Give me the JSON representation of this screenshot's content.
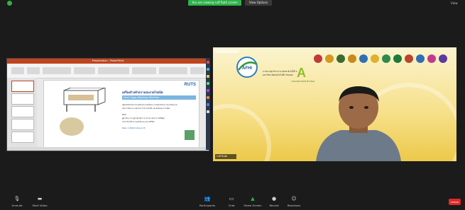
{
  "top_bar": {
    "share_banner": "You are viewing ruff Ruth screen",
    "view_options": "View Options",
    "view_label": "View"
  },
  "ppt": {
    "window_title": "Presentation - PowerPoint",
    "slide": {
      "brand": "RUTS",
      "title": "เครื่องล้างทำความสะอาดไข่เป็ด",
      "subtitle": "Duck Eggs Washing Machine",
      "body_lines": [
        "ผลิตภัณฑ์นวัตกรรมเครื่องล้างไข่เป็ดแบบ Interactive ไซเบอร์ต้นแบบ",
        "ลดการใช้แรงงานคนในการล้างไข่เป็ด และลดต้นทุนการผลิต",
        "",
        "Ruth",
        "ผู้ดำเนินงาน: ผู้ช่วยศาสตราจารย์ ดร.สมชาย ใจดีมีสุข",
        "สาขาวิชาวิศวกรรมเครื่องกล มทร.ศรีวิชัย",
        "",
        "ติดต่อ: ruth@rmutsv.ac.th"
      ]
    }
  },
  "video": {
    "name": "ruff Ruth",
    "org_logo_text": "AFHI",
    "org_subtext": "การประชุมวิชาการระดับชาติ ครั้งที่ 3 มหาวิทยาลัยเทคโนโลยีราชมงคล",
    "event_logo_text": "A",
    "event_subtext": "งานเกษตรแห่งชาติ 2564"
  },
  "toolbar": {
    "items": [
      {
        "label": "Unmute",
        "icon": "microphone-icon"
      },
      {
        "label": "Start Video",
        "icon": "video-camera-icon"
      },
      {
        "label": "Participants",
        "icon": "participants-icon"
      },
      {
        "label": "Chat",
        "icon": "chat-icon"
      },
      {
        "label": "Share Screen",
        "icon": "share-screen-icon"
      },
      {
        "label": "Record",
        "icon": "record-icon"
      },
      {
        "label": "Reactions",
        "icon": "reactions-icon"
      }
    ],
    "end": "Leave"
  },
  "colors": {
    "share_banner": "#2fb24a",
    "ppt_accent": "#c0451f",
    "end_button": "#e02828",
    "video_bg": "#f6df86"
  }
}
